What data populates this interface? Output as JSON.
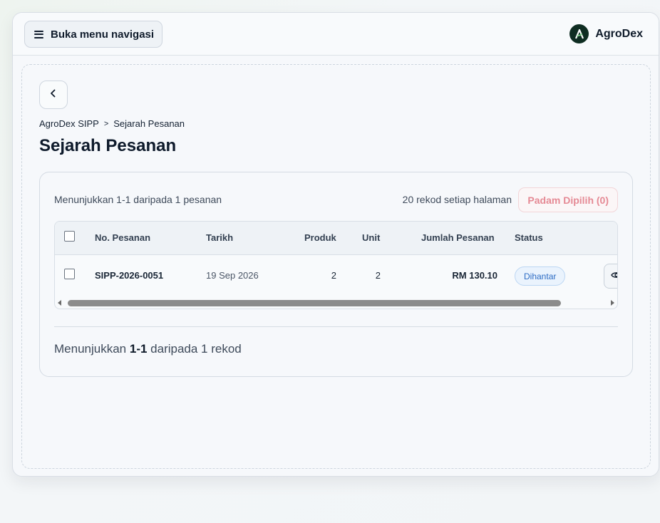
{
  "header": {
    "nav_button_label": "Buka menu navigasi",
    "brand_name": "AgroDex",
    "brand_color": "#0f2d22"
  },
  "breadcrumb": {
    "root": "AgroDex SIPP",
    "separator": ">",
    "current": "Sejarah Pesanan"
  },
  "page": {
    "title": "Sejarah Pesanan"
  },
  "card": {
    "summary": "Menunjukkan 1-1 daripada 1 pesanan",
    "per_page": "20 rekod setiap halaman",
    "delete_label": "Padam Dipilih (0)",
    "delete_color": "#e58a95"
  },
  "table": {
    "columns": [
      "No. Pesanan",
      "Tarikh",
      "Produk",
      "Unit",
      "Jumlah Pesanan",
      "Status"
    ],
    "rows": [
      {
        "order_no": "SIPP-2026-0051",
        "date": "19 Sep 2026",
        "products": "2",
        "units": "2",
        "total": "RM 130.10",
        "status": "Dihantar",
        "action_icon": "eye-icon"
      }
    ],
    "status_color": "#2c6bc4"
  },
  "footer": {
    "prefix": "Menunjukkan",
    "range": "1-1",
    "suffix": "daripada 1 rekod"
  }
}
